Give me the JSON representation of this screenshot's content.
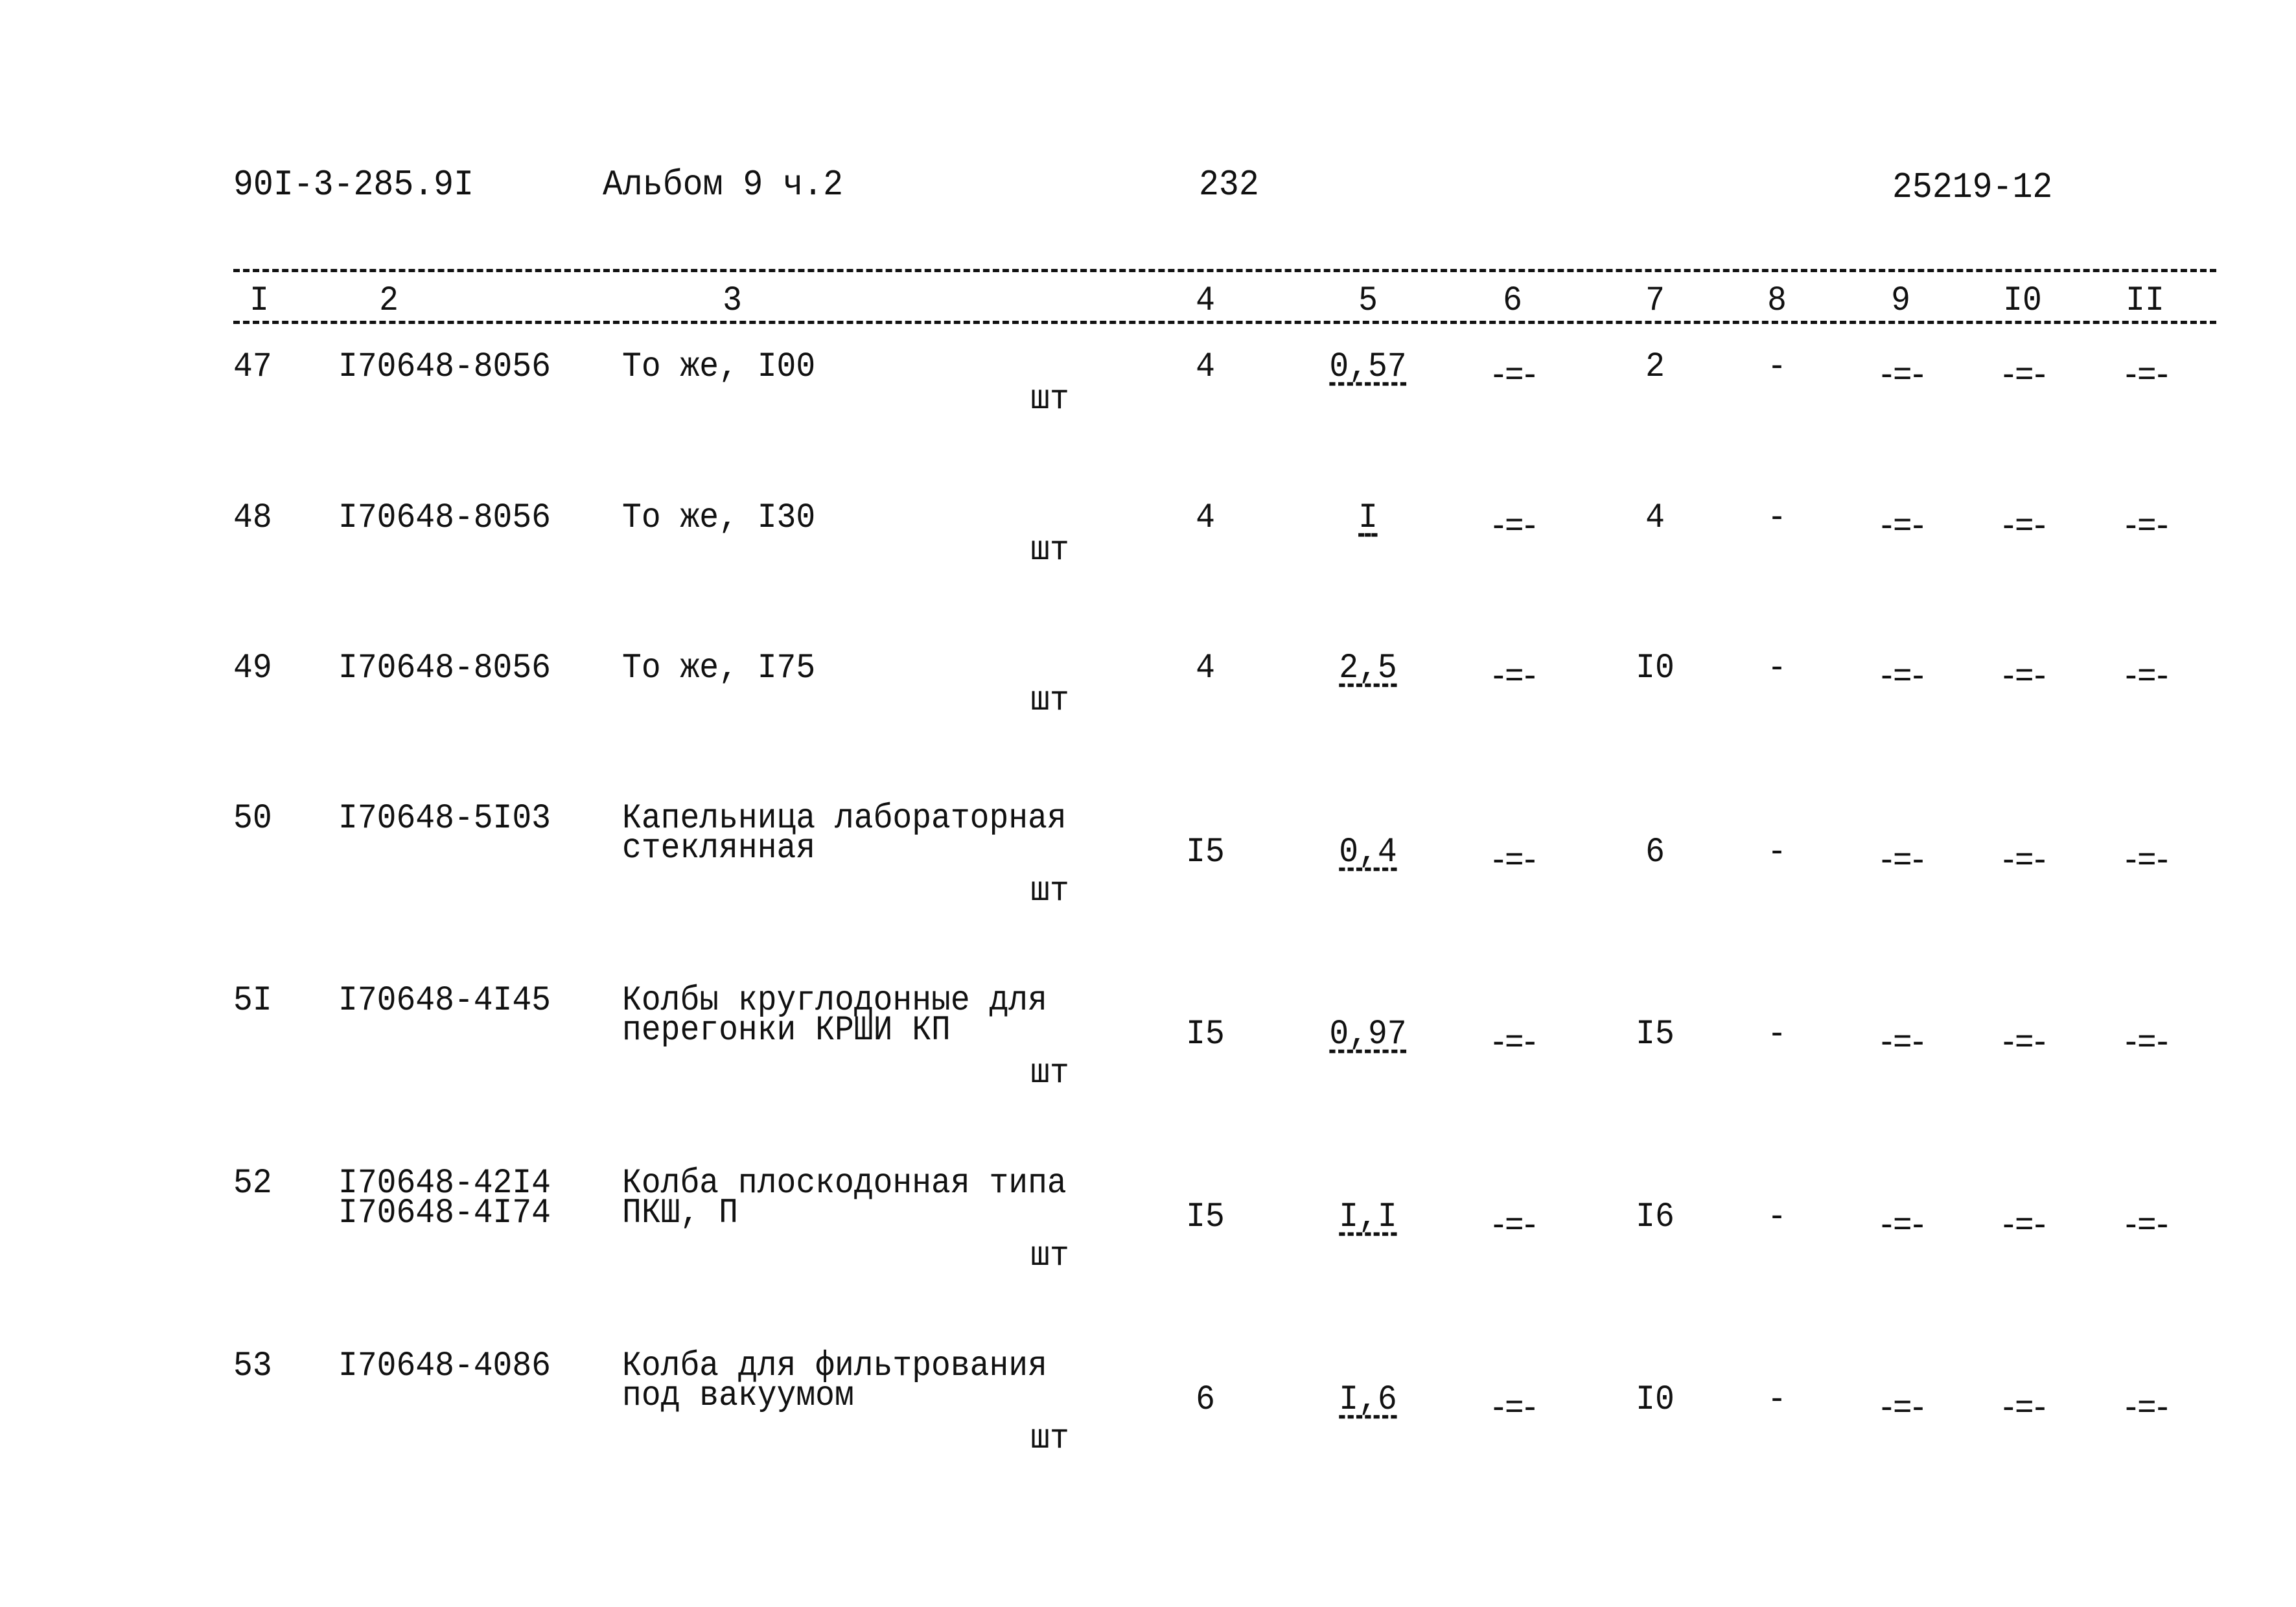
{
  "header": {
    "doc_code": "90I-3-285.9I",
    "album": "Альбом 9 ч.2",
    "page": "232",
    "sheet": "25219-12"
  },
  "columns": [
    "I",
    "2",
    "3",
    "4",
    "5",
    "6",
    "7",
    "8",
    "9",
    "I0",
    "II"
  ],
  "rows": [
    {
      "n": "47",
      "code": [
        "I70648-8056"
      ],
      "name": [
        "То же, I00"
      ],
      "unit": "шт",
      "c4": "4",
      "c5": "0,57",
      "c6": "-=-",
      "c7": "2",
      "c8": "-",
      "c9": "-=-",
      "c10": "-=-",
      "c11": "-=-"
    },
    {
      "n": "48",
      "code": [
        "I70648-8056"
      ],
      "name": [
        "То же, I30"
      ],
      "unit": "шт",
      "c4": "4",
      "c5": "I",
      "c6": "-=-",
      "c7": "4",
      "c8": "-",
      "c9": "-=-",
      "c10": "-=-",
      "c11": "-=-"
    },
    {
      "n": "49",
      "code": [
        "I70648-8056"
      ],
      "name": [
        "То же, I75"
      ],
      "unit": "шт",
      "c4": "4",
      "c5": "2,5",
      "c6": "-=-",
      "c7": "I0",
      "c8": "-",
      "c9": "-=-",
      "c10": "-=-",
      "c11": "-=-"
    },
    {
      "n": "50",
      "code": [
        "I70648-5I03"
      ],
      "name": [
        "Капельница лабораторная",
        "стеклянная"
      ],
      "unit": "шт",
      "c4": "I5",
      "c5": "0,4",
      "c6": "-=-",
      "c7": "6",
      "c8": "-",
      "c9": "-=-",
      "c10": "-=-",
      "c11": "-=-"
    },
    {
      "n": "5I",
      "code": [
        "I70648-4I45"
      ],
      "name": [
        "Колбы круглодонные для",
        "перегонки КРШИ КП"
      ],
      "unit": "шт",
      "c4": "I5",
      "c5": "0,97",
      "c6": "-=-",
      "c7": "I5",
      "c8": "-",
      "c9": "-=-",
      "c10": "-=-",
      "c11": "-=-"
    },
    {
      "n": "52",
      "code": [
        "I70648-42I4",
        "I70648-4I74"
      ],
      "name": [
        "Колба плоскодонная типа",
        "ПКШ, П"
      ],
      "unit": "шт",
      "c4": "I5",
      "c5": "I,I",
      "c6": "-=-",
      "c7": "I6",
      "c8": "-",
      "c9": "-=-",
      "c10": "-=-",
      "c11": "-=-"
    },
    {
      "n": "53",
      "code": [
        "I70648-4086"
      ],
      "name": [
        "Колба для фильтрования",
        "под вакуумом"
      ],
      "unit": "шт",
      "c4": "6",
      "c5": "I,6",
      "c6": "-=-",
      "c7": "I0",
      "c8": "-",
      "c9": "-=-",
      "c10": "-=-",
      "c11": "-=-"
    }
  ]
}
